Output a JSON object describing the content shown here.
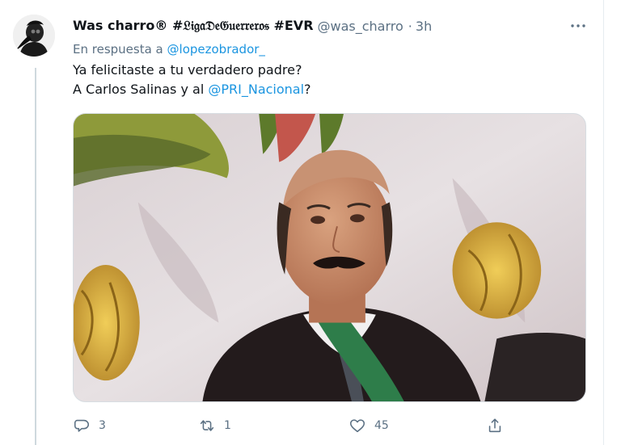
{
  "tweet": {
    "author": {
      "name": "Was charro® #𝔏𝔦𝔤𝔞𝔇𝔢𝔊𝔲𝔢𝔯𝔯𝔢𝔯𝔬𝔰 #EVR",
      "handle": "@was_charro",
      "separator": "·",
      "time": "3h"
    },
    "reply_prefix": "En respuesta a",
    "reply_to": "@lopezobrador_",
    "text_line1": "Ya felicitaste a tu verdadero padre?",
    "text_line2_before": "A Carlos Salinas y al ",
    "text_line2_mention": "@PRI_Nacional",
    "text_line2_after": "?",
    "metrics": {
      "replies": "3",
      "retweets": "1",
      "likes": "45"
    }
  },
  "colors": {
    "text_primary": "#0f1419",
    "text_secondary": "#5b7083",
    "link": "#1b95e0",
    "divider": "#e6ecf0"
  },
  "icons": {
    "reply": "reply-icon",
    "retweet": "retweet-icon",
    "like": "heart-icon",
    "share": "share-icon",
    "more": "more-icon"
  }
}
